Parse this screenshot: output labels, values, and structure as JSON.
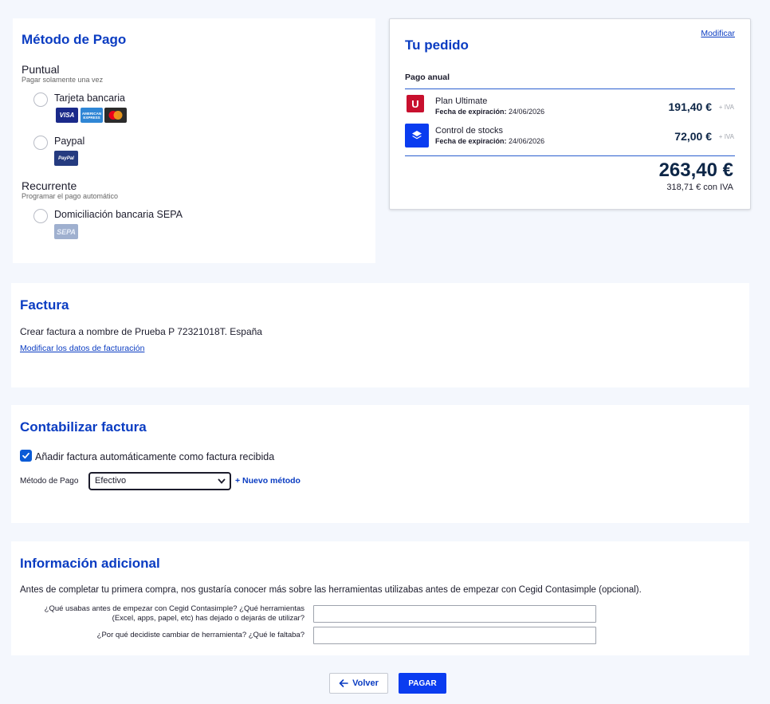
{
  "payment": {
    "title": "Método de Pago",
    "groups": [
      {
        "title": "Puntual",
        "subtitle": "Pagar solamente una vez",
        "options": [
          {
            "label": "Tarjeta bancaria",
            "logos": [
              "VISA",
              "AMERICAN EXPRESS",
              "mastercard"
            ]
          },
          {
            "label": "Paypal",
            "logos": [
              "PayPal"
            ]
          }
        ]
      },
      {
        "title": "Recurrente",
        "subtitle": "Programar el pago automático",
        "options": [
          {
            "label": "Domiciliación bancaria SEPA",
            "logos": [
              "SEPA"
            ]
          }
        ]
      }
    ]
  },
  "order": {
    "title": "Tu pedido",
    "modify_link": "Modificar",
    "billing_period": "Pago anual",
    "items": [
      {
        "name": "Plan Ultimate",
        "exp_label": "Fecha de expiración:",
        "exp_date": "24/06/2026",
        "price": "191,40 €",
        "tax_note": "+ IVA",
        "icon": "U",
        "icon_color": "#c8102e"
      },
      {
        "name": "Control de stocks",
        "exp_label": "Fecha de expiración:",
        "exp_date": "24/06/2026",
        "price": "72,00 €",
        "tax_note": "+ IVA",
        "icon": "layers-icon",
        "icon_color": "#0a3cf0"
      }
    ],
    "total": "263,40 €",
    "total_with_tax": "318,71 € con IVA"
  },
  "invoice": {
    "title": "Factura",
    "text": "Crear factura a nombre de Prueba P 72321018T. España",
    "modify_link": "Modificar los datos de facturación"
  },
  "accounting": {
    "title": "Contabilizar factura",
    "checkbox_label": "Añadir factura automáticamente como factura recibida",
    "checkbox_checked": true,
    "method_label": "Método de Pago",
    "method_value": "Efectivo",
    "new_method": "+ Nuevo método"
  },
  "info": {
    "title": "Información adicional",
    "intro": "Antes de completar tu primera compra, nos gustaría conocer más sobre las herramientas utilizabas antes de empezar con Cegid Contasimple (opcional).",
    "q1_line1": "¿Qué usabas antes de empezar con Cegid Contasimple? ¿Qué herramientas",
    "q1_line2": "(Excel, apps, papel, etc) has dejado o dejarás de utilizar?",
    "q2": "¿Por qué decidiste cambiar de herramienta? ¿Qué le faltaba?",
    "q1_value": "",
    "q2_value": ""
  },
  "buttons": {
    "back": "Volver",
    "pay": "PAGAR"
  },
  "colors": {
    "accent": "#0a3cc2",
    "primary_button": "#0a3cf0",
    "background": "#f4f7fd"
  }
}
